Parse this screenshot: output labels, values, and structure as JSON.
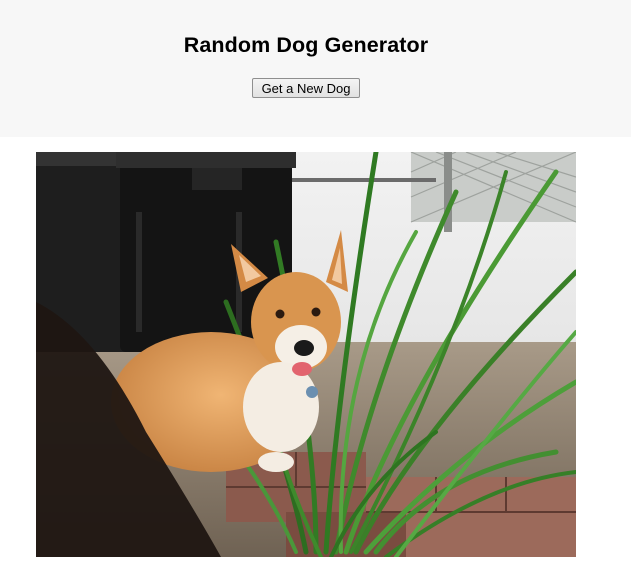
{
  "page": {
    "title": "Random Dog Generator"
  },
  "controls": {
    "new_dog_label": "Get a New Dog"
  },
  "photo": {
    "subject": "corgi-dog-photo",
    "colors": {
      "header_background": "#f7f7f7",
      "fur": "#d9954f",
      "plant": "#3f8a2c"
    }
  }
}
